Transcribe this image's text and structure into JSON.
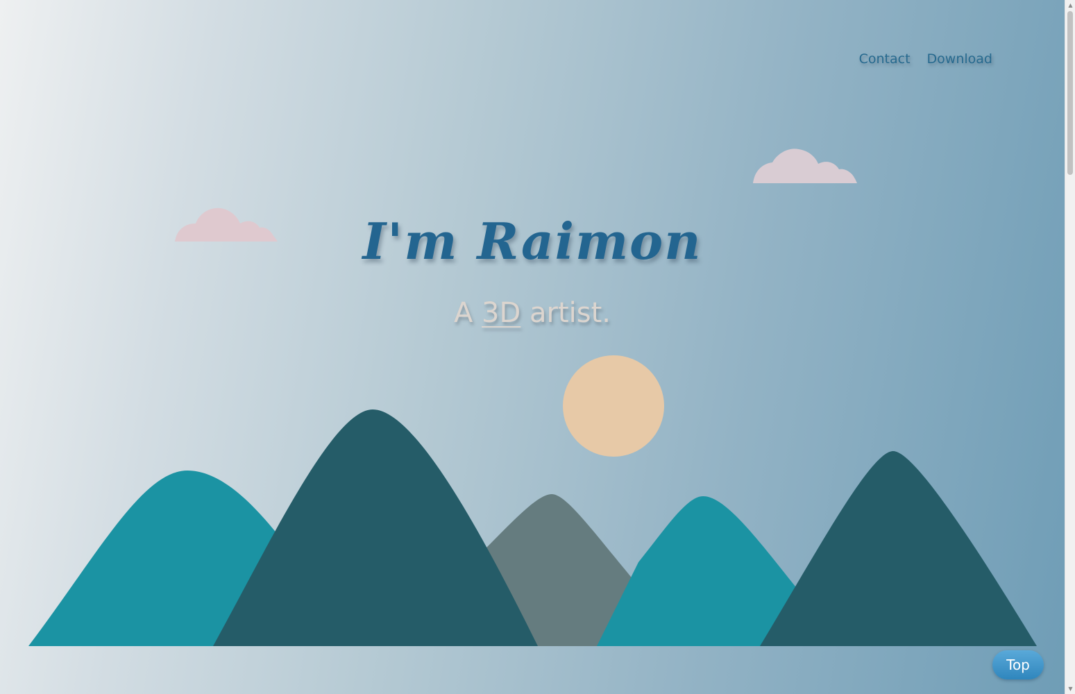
{
  "nav": {
    "contact_label": "Contact",
    "download_label": "Download"
  },
  "hero": {
    "title": "I'm Raimon",
    "subtitle_prefix": "A ",
    "subtitle_highlight": "3D",
    "subtitle_suffix": " artist."
  },
  "top_button": {
    "label": "Top"
  },
  "colors": {
    "title": "#236590",
    "nav_link": "#276a8f",
    "sun": "#e7c9a7",
    "mountain_teal": "#1b93a3",
    "mountain_dark": "#255c68",
    "mountain_grey": "#657c7f",
    "cloud_pink": "#dfc9cf",
    "top_button": "#3a93c8"
  }
}
